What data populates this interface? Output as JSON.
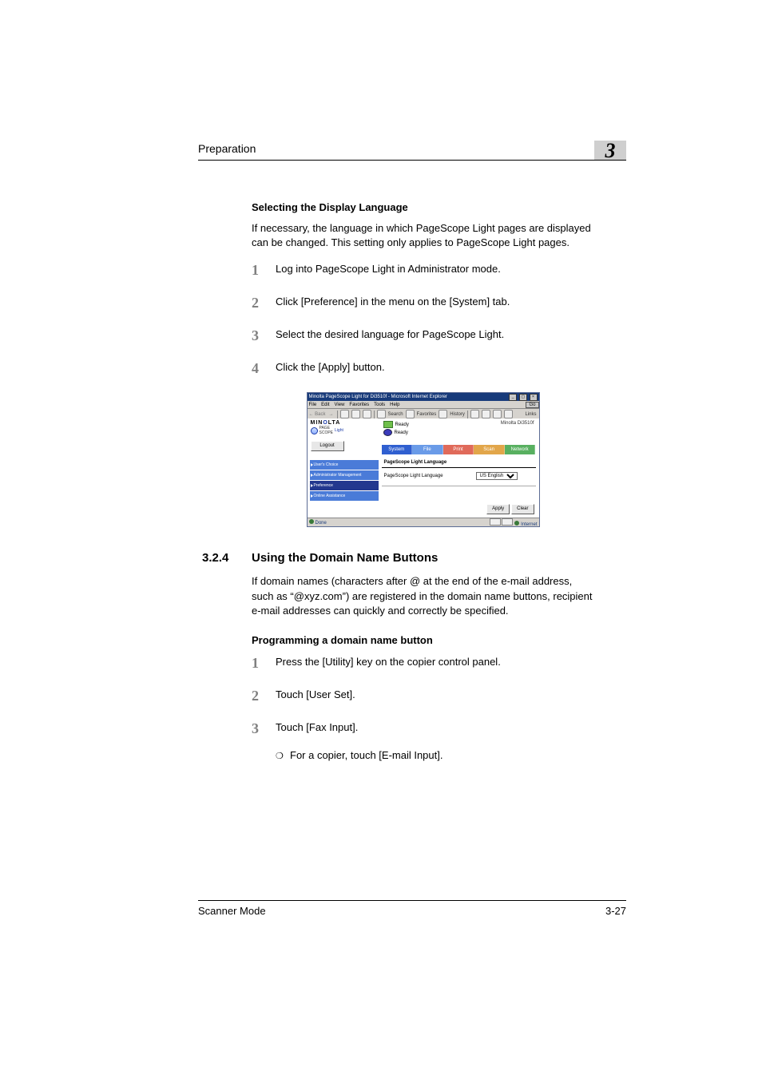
{
  "header": {
    "chapter_title": "Preparation",
    "chapter_num": "3"
  },
  "sec1": {
    "heading": "Selecting the Display Language",
    "para": "If necessary, the language in which PageScope Light pages are displayed can be changed. This setting only applies to PageScope Light pages.",
    "steps": [
      "Log into PageScope Light in Administrator mode.",
      "Click [Preference] in the menu on the [System] tab.",
      "Select the desired language for PageScope Light.",
      "Click the [Apply] button."
    ]
  },
  "sec2": {
    "num": "3.2.4",
    "title": "Using the Domain Name Buttons",
    "para": "If domain names (characters after @ at the end of the e-mail address, such as “@xyz.com”) are registered in the domain name buttons, recipient e-mail addresses can quickly and correctly be specified.",
    "heading": "Programming a domain name button",
    "steps": [
      "Press the [Utility] key on the copier control panel.",
      "Touch [User Set].",
      "Touch [Fax Input]."
    ],
    "sub": "For a copier, touch [E-mail Input]."
  },
  "footer": {
    "left": "Scanner Mode",
    "right": "3-27"
  },
  "shot": {
    "title": "Minolta PageScope Light for Di3510f - Microsoft Internet Explorer",
    "menus": [
      "File",
      "Edit",
      "View",
      "Favorites",
      "Tools",
      "Help"
    ],
    "go": "Go",
    "toolbar": {
      "back": "Back",
      "search": "Search",
      "favs": "Favorites",
      "history": "History",
      "links": "Links"
    },
    "brand": "MIN",
    "brand_o": "O",
    "brand_rest": "LTA",
    "logo_sub": "Light",
    "logout": "Logout",
    "ready1": "Ready",
    "ready2": "Ready",
    "model": "Minolta Di3510f",
    "tabs": {
      "system": "System",
      "file": "File",
      "print": "Print",
      "scan": "Scan",
      "network": "Network"
    },
    "nav": [
      "User's Choice",
      "Administrator Management",
      "Preference",
      "Online Assistance"
    ],
    "main_heading": "PageScope Light Language",
    "main_label": "PageScope Light Language",
    "select_value": "US English",
    "apply": "Apply",
    "clear": "Clear",
    "status_done": "Done",
    "status_zone": "Internet"
  }
}
